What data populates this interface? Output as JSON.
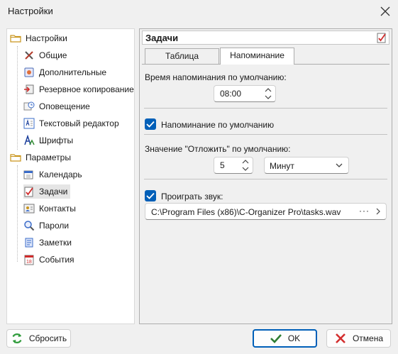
{
  "window": {
    "title": "Настройки"
  },
  "tree": {
    "group1": "Настройки",
    "group1_items": [
      "Общие",
      "Дополнительные",
      "Резервное копирование",
      "Оповещение",
      "Текстовый редактор",
      "Шрифты"
    ],
    "group2": "Параметры",
    "group2_items": [
      "Календарь",
      "Задачи",
      "Контакты",
      "Пароли",
      "Заметки",
      "События"
    ],
    "selected": "Задачи"
  },
  "panel": {
    "title": "Задачи",
    "tabs": [
      "Таблица",
      "Напоминание"
    ],
    "active_tab": "Напоминание",
    "reminder_time_label": "Время напоминания по умолчанию:",
    "reminder_time_value": "08:00",
    "default_reminder_label": "Напоминание по умолчанию",
    "default_reminder_checked": true,
    "snooze_label": "Значение \"Отложить\" по умолчанию:",
    "snooze_value": "5",
    "snooze_unit": "Минут",
    "play_sound_label": "Проиграть звук:",
    "play_sound_checked": true,
    "sound_path": "C:\\Program Files (x86)\\C-Organizer Pro\\tasks.wav",
    "browse_label": "···"
  },
  "buttons": {
    "reset": "Сбросить",
    "ok": "OK",
    "cancel": "Отмена"
  },
  "colors": {
    "accent": "#005fb8",
    "ok_icon": "#2e7d32",
    "cancel_icon": "#d32f2f",
    "folder": "#e8b84a"
  }
}
